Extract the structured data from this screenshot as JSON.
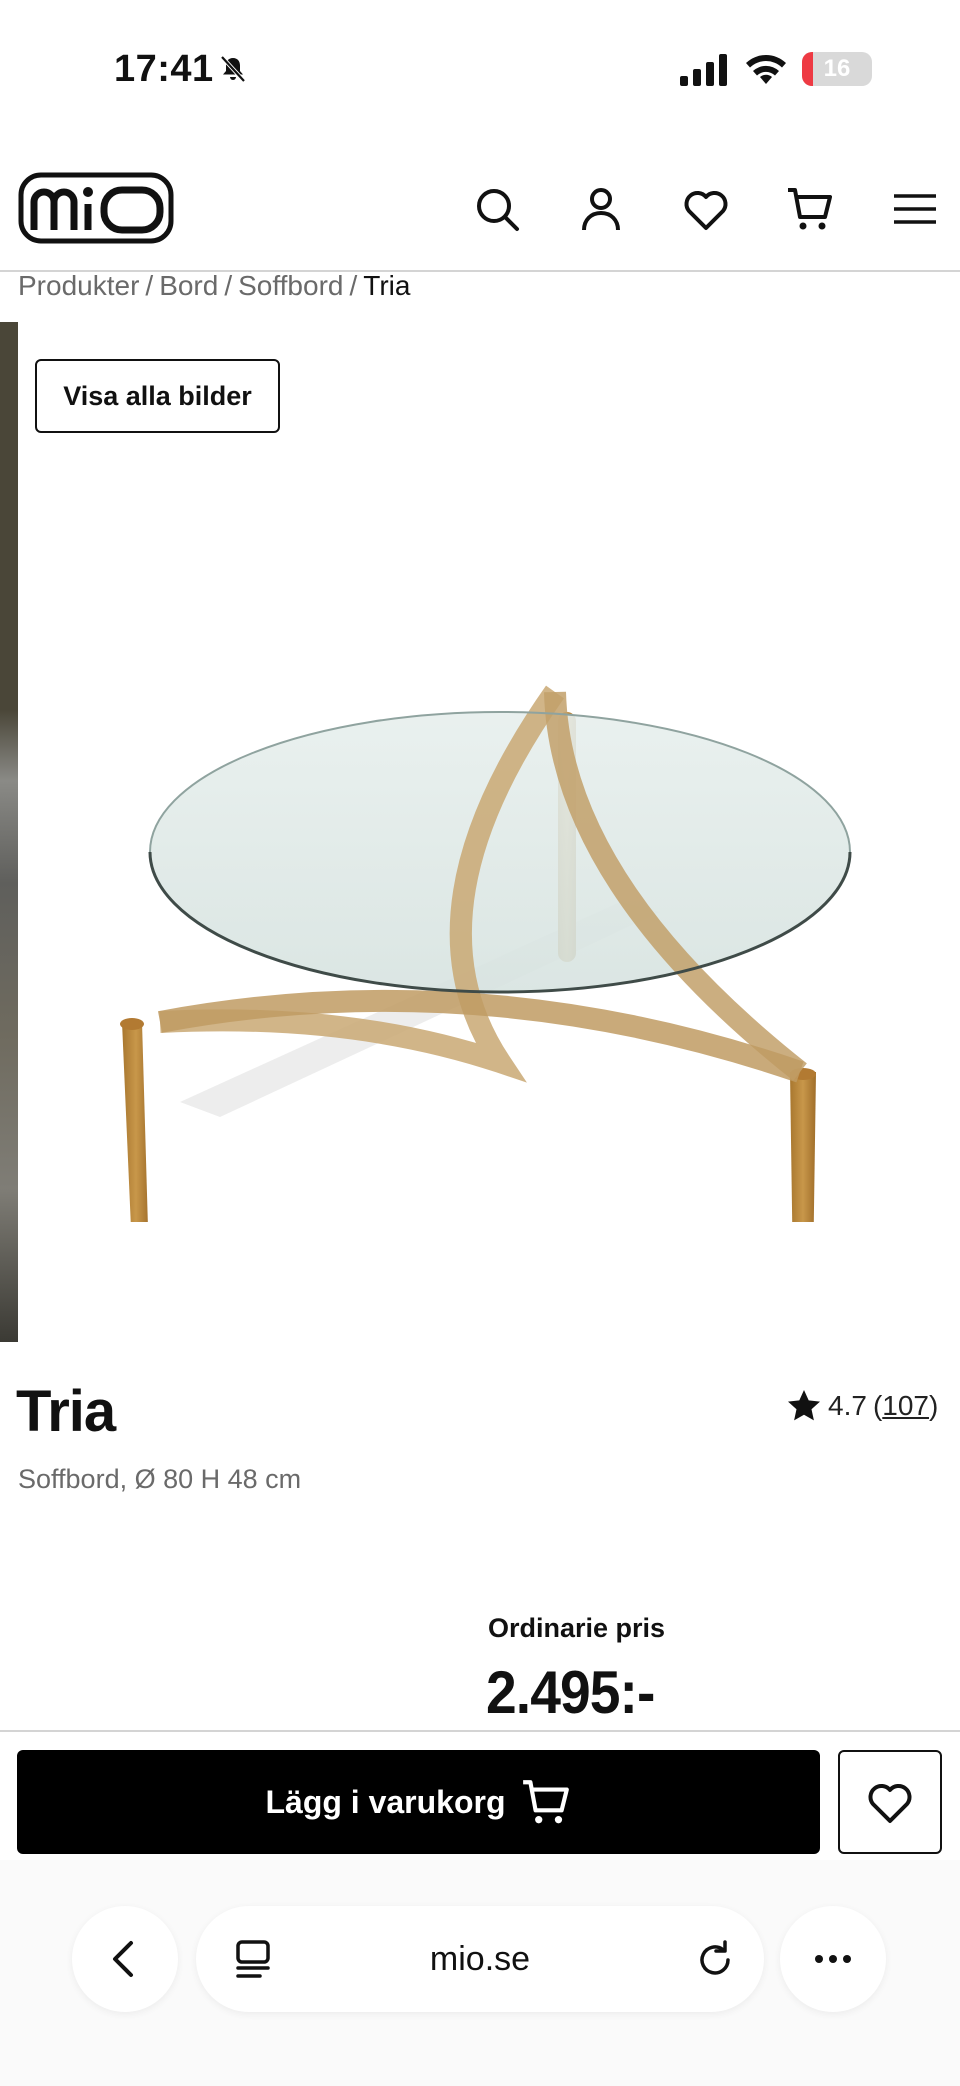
{
  "status_bar": {
    "time": "17:41",
    "battery": "16",
    "battery_level": 0.16,
    "battery_color": "#ee3a43"
  },
  "header": {
    "logo_text": "MiO",
    "icons": [
      "search-icon",
      "account-icon",
      "heart-icon",
      "cart-icon",
      "menu-icon"
    ]
  },
  "breadcrumb": {
    "items": [
      "Produkter",
      "Bord",
      "Soffbord"
    ],
    "current": "Tria",
    "separator": "/"
  },
  "gallery": {
    "view_all_label": "Visa alla bilder"
  },
  "product": {
    "title": "Tria",
    "subtitle": "Soffbord, Ø 80 H 48 cm",
    "rating": "4.7",
    "rating_count": "107",
    "rating_open": "(",
    "rating_close": ")",
    "price_label": "Ordinarie pris",
    "price": "2.495:-"
  },
  "actions": {
    "add_to_cart_label": "Lägg i varukorg"
  },
  "browser": {
    "url": "mio.se"
  }
}
